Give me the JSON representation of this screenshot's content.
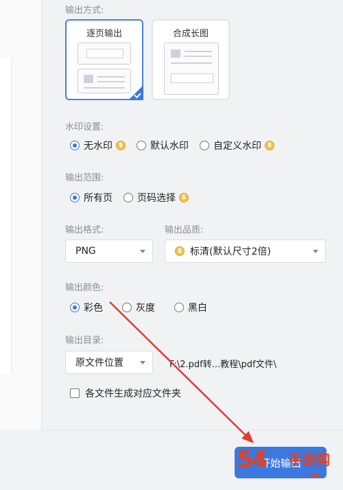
{
  "output_mode": {
    "label": "输出方式:",
    "options": [
      {
        "label": "逐页输出",
        "selected": true
      },
      {
        "label": "合成长图",
        "selected": false
      }
    ]
  },
  "watermark_settings": {
    "label": "水印设置:",
    "options": [
      {
        "label": "无水印",
        "selected": true,
        "vip": true
      },
      {
        "label": "默认水印",
        "selected": false,
        "vip": false
      },
      {
        "label": "自定义水印",
        "selected": false,
        "vip": true
      }
    ]
  },
  "output_range": {
    "label": "输出范围:",
    "options": [
      {
        "label": "所有页",
        "selected": true,
        "vip": false
      },
      {
        "label": "页码选择",
        "selected": false,
        "vip": true
      }
    ]
  },
  "output_format": {
    "label": "输出格式:",
    "value": "PNG"
  },
  "output_quality": {
    "label": "输出品质:",
    "value": "标清(默认尺寸2倍)",
    "vip": true
  },
  "output_color": {
    "label": "输出颜色:",
    "options": [
      {
        "label": "彩色",
        "selected": true
      },
      {
        "label": "灰度",
        "selected": false
      },
      {
        "label": "黑白",
        "selected": false
      }
    ]
  },
  "output_directory": {
    "label": "输出目录:",
    "select_value": "原文件位置",
    "path": "F:\\2.pdf转...教程\\pdf文件\\",
    "subfolder_checkbox": {
      "label": "各文件生成对应文件夹",
      "checked": false
    }
  },
  "start_button": {
    "label": "开始输出"
  },
  "watermark_overlay": {
    "number": "54",
    "text": "手游网",
    "url": ".cn"
  },
  "colors": {
    "accent": "#3b78e0",
    "coin": "#f1c24a",
    "arrow": "#e03a2f"
  }
}
